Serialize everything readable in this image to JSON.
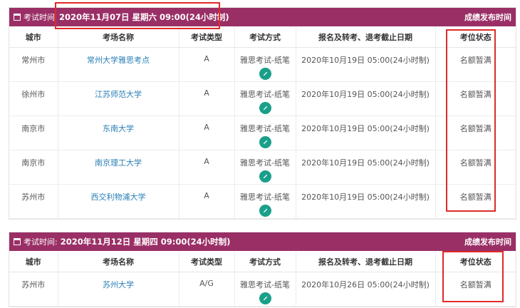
{
  "columns": [
    "城市",
    "考场名称",
    "考试类型",
    "考试方式",
    "报名及转考、退考截止日期",
    "考位状态"
  ],
  "blocks": [
    {
      "label": "考试时间",
      "date": "2020年11月07日 星期六 09:00(24小时制)",
      "right": "成绩发布时间",
      "rows": [
        {
          "city": "常州市",
          "venue": "常州大学雅思考点",
          "type": "A",
          "mode": "雅思考试-纸笔",
          "deadline": "2020年10月19日 05:00(24小时制)",
          "status": "名额暂满"
        },
        {
          "city": "徐州市",
          "venue": "江苏师范大学",
          "type": "A",
          "mode": "雅思考试-纸笔",
          "deadline": "2020年10月19日 05:00(24小时制)",
          "status": "名额暂满"
        },
        {
          "city": "南京市",
          "venue": "东南大学",
          "type": "A",
          "mode": "雅思考试-纸笔",
          "deadline": "2020年10月19日 05:00(24小时制)",
          "status": "名额暂满"
        },
        {
          "city": "南京市",
          "venue": "南京理工大学",
          "type": "A",
          "mode": "雅思考试-纸笔",
          "deadline": "2020年10月19日 05:00(24小时制)",
          "status": "名额暂满"
        },
        {
          "city": "苏州市",
          "venue": "西交利物浦大学",
          "type": "A",
          "mode": "雅思考试-纸笔",
          "deadline": "2020年10月19日 05:00(24小时制)",
          "status": "名额暂满"
        }
      ]
    },
    {
      "label": "考试时间:",
      "date": "2020年11月12日 星期四 09:00(24小时制)",
      "right": "成绩发布时间",
      "rows": [
        {
          "city": "苏州市",
          "venue": "苏州大学",
          "type": "A/G",
          "mode": "雅思考试-纸笔",
          "deadline": "2020年10月26日 05:00(24小时制)",
          "status": "名额暂满"
        }
      ]
    }
  ],
  "colors": {
    "header_bar": "#9a2f66",
    "link": "#2a7fb5",
    "edit_icon_bg": "#1a9f8a",
    "highlight": "#e02a2a"
  }
}
